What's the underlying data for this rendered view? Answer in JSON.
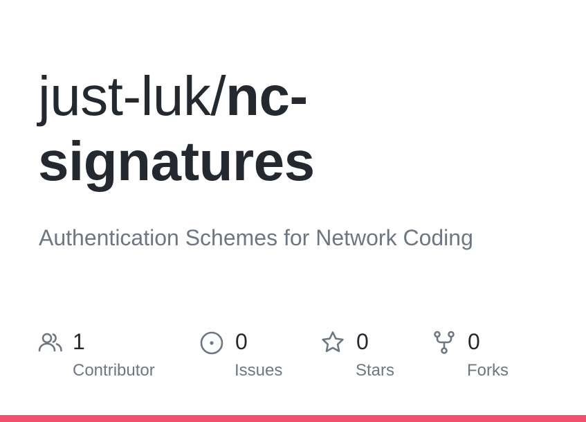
{
  "repo": {
    "owner": "just-luk/",
    "name": "nc-signatures",
    "description": "Authentication Schemes for Network Coding"
  },
  "stats": [
    {
      "icon": "people-icon",
      "count": "1",
      "label": "Contributor"
    },
    {
      "icon": "issue-icon",
      "count": "0",
      "label": "Issues"
    },
    {
      "icon": "star-icon",
      "count": "0",
      "label": "Stars"
    },
    {
      "icon": "fork-icon",
      "count": "0",
      "label": "Forks"
    }
  ],
  "colors": {
    "accent": "#f0506e",
    "text": "#24292f",
    "muted": "#6e7781"
  }
}
